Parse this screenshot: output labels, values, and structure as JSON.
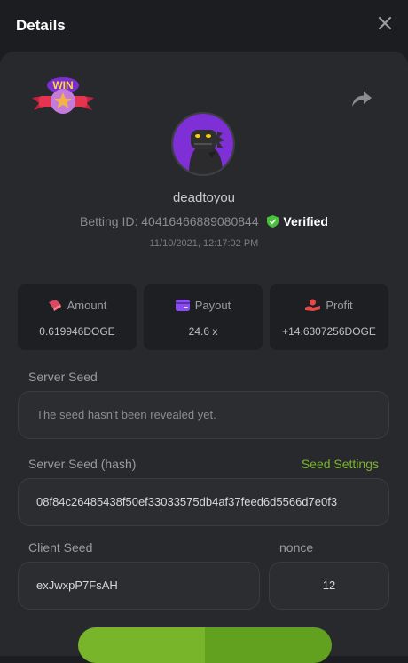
{
  "header": {
    "title": "Details"
  },
  "icons": {
    "close": "close-icon",
    "share": "share-icon",
    "badge": "win-badge",
    "verified": "verified-shield-icon"
  },
  "badge": {
    "text": "WIN"
  },
  "user": {
    "name": "deadtoyou"
  },
  "bet": {
    "id_label": "Betting ID:",
    "id_value": "40416466889080844",
    "verified_label": "Verified",
    "datetime": "11/10/2021, 12:17:02 PM"
  },
  "stats": {
    "amount": {
      "label": "Amount",
      "value": "0.619946DOGE"
    },
    "payout": {
      "label": "Payout",
      "value": "24.6 x"
    },
    "profit": {
      "label": "Profit",
      "value": "+14.6307256DOGE"
    }
  },
  "server_seed": {
    "label": "Server Seed",
    "placeholder": "The seed hasn't been revealed yet."
  },
  "server_seed_hash": {
    "label": "Server Seed (hash)",
    "settings_link": "Seed Settings",
    "value": "08f84c26485438f50ef33033575db4af37feed6d5566d7e0f3"
  },
  "client_seed": {
    "label": "Client Seed",
    "value": "exJwxpP7FsAH"
  },
  "nonce": {
    "label": "nonce",
    "value": "12"
  },
  "colors": {
    "accent_green": "#7ab42a",
    "background": "#1c1d20",
    "panel": "#27292c"
  }
}
